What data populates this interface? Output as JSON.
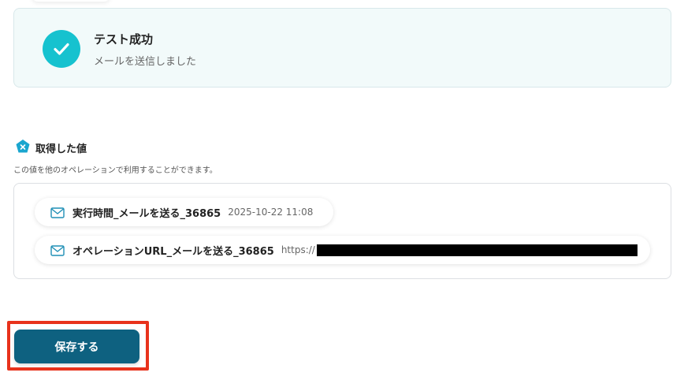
{
  "success": {
    "title": "テスト成功",
    "message": "メールを送信しました",
    "icon": "check-circle-icon"
  },
  "values_section": {
    "title": "取得した値",
    "description": "この値を他のオペレーションで利用することができます。",
    "icon": "x-badge-icon",
    "items": [
      {
        "label": "実行時間_メールを送る_36865",
        "value": "2025-10-22 11:08",
        "icon": "mail-icon"
      },
      {
        "label": "オペレーションURL_メールを送る_36865",
        "value": "https://",
        "icon": "mail-icon",
        "redacted": true
      }
    ]
  },
  "actions": {
    "save_label": "保存する"
  },
  "colors": {
    "accent": "#16c2cf",
    "primary_button": "#0e6180",
    "highlight": "#e8321c",
    "success_bg": "#f2fafa"
  }
}
